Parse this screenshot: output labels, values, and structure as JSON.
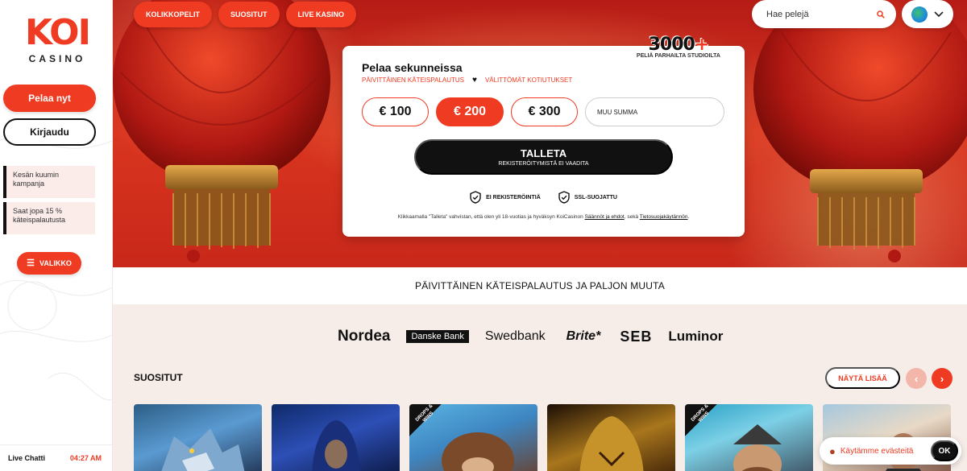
{
  "sidebar": {
    "logo_mark": "KOI",
    "logo_sub": "CASINO",
    "play_label": "Pelaa nyt",
    "login_label": "Kirjaudu",
    "promos": [
      "Kesän kuumin kampanja",
      "Saat jopa 15 % käteispalautusta"
    ],
    "menu_label": "VALIKKO",
    "menu_icon": "hamburger-icon",
    "footer": {
      "chat_label": "Live Chatti",
      "time": "04:27 AM"
    }
  },
  "nav": {
    "items": [
      "KOLIKKOPELIT",
      "SUOSITUT",
      "LIVE KASINO"
    ],
    "search_placeholder": "Hae pelejä",
    "search_icon": "search-icon",
    "language_icon": "globe-icon"
  },
  "deposit_card": {
    "badge_number": "3000",
    "badge_plus": "+",
    "badge_sub": "PELIÄ PARHAILTA STUDIOILTA",
    "title": "Pelaa sekunneissa",
    "feature_1": "PÄIVITTÄINEN KÄTEISPALAUTUS",
    "feature_2": "VÄLITTÖMÄT KOTIUTUKSET",
    "amounts": [
      "€ 100",
      "€ 200",
      "€ 300"
    ],
    "selected_amount": "€ 200",
    "other_placeholder": "MUU SUMMA",
    "deposit_label": "TALLETA",
    "deposit_sub": "REKISTERÖITYMISTÄ EI VAADITA",
    "trust_1": "EI REKISTERÖINTIÄ",
    "trust_2": "SSL-SUOJATTU",
    "terms_pre": "Klikkaamalla \"Talleta\" vahvistan, että olen yli 18-vuotias ja hyväksyn KoiCasinon",
    "terms_link_1": "Säännöt ja ehdot",
    "terms_mid": ", sekä",
    "terms_link_2": "Tietosuojakäytännön",
    "terms_end": "."
  },
  "band_text": "PÄIVITTÄINEN KÄTEISPALAUTUS JA PALJON MUUTA",
  "banks": [
    "Nordea",
    "Danske Bank",
    "Swedbank",
    "Brite*",
    "SEB",
    "Luminor"
  ],
  "popular": {
    "title": "SUOSITUT",
    "show_more": "NÄYTÄ LISÄÄ",
    "prev_icon": "chevron-left-icon",
    "next_icon": "chevron-right-icon",
    "drops_badge": "DROPS & WINS"
  },
  "cookie": {
    "text": "Käytämme evästeitä",
    "ok_label": "OK",
    "icon": "cookie-icon"
  },
  "colors": {
    "accent": "#ee3b22",
    "dark": "#111111",
    "strip": "#f6ede9"
  }
}
